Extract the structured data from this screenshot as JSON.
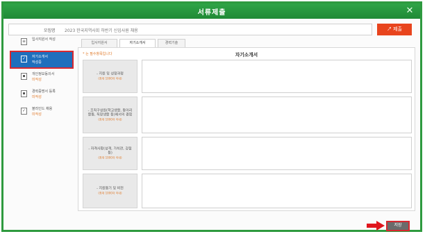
{
  "window": {
    "title": "서류제출",
    "close_glyph": "✕"
  },
  "subject": {
    "label": "모집명",
    "value": "2023 한국지역사회 하반기 신입사원 채용"
  },
  "submit_button": "↗ 제출",
  "sidebar": {
    "items": [
      {
        "label": "입사지원서 작성",
        "status": "",
        "icon": "document-icon",
        "active": false
      },
      {
        "label": "자기소개서",
        "status": "작성중",
        "icon": "edit-icon",
        "active": true
      },
      {
        "label": "개인정보동의서",
        "status": "미작성",
        "icon": "consent-icon",
        "active": false
      },
      {
        "label": "경력증명서 등록",
        "status": "미작성",
        "icon": "certificate-icon",
        "active": false
      },
      {
        "label": "블라인드 채용",
        "status": "미작성",
        "icon": "check-icon",
        "active": false
      }
    ]
  },
  "tabs": [
    {
      "label": "입사지원서",
      "active": false
    },
    {
      "label": "자기소개서",
      "active": true
    },
    {
      "label": "경력기술",
      "active": false
    }
  ],
  "form": {
    "required_note": "* 는 필수항목입니다",
    "title": "자기소개서",
    "questions": [
      {
        "text": "- 지원 및 성장과정",
        "limit": "(최대 1000자 이내)"
      },
      {
        "text": "- 조직구성원(학교생활, 동아리활동, 직장생활 등)에서의 경험",
        "limit": "(최대 1000자 이내)"
      },
      {
        "text": "- 자격사항(성격, 가치관, 강점 등)",
        "limit": "(최대 1000자 이내)"
      },
      {
        "text": "- 지원동기 및 비전",
        "limit": "(최대 1000자 이내)"
      }
    ]
  },
  "save_button": "저장",
  "colors": {
    "frame": "#2e9a3f",
    "accent": "#1f6fbd",
    "submit": "#e8441d",
    "highlight": "#d8282f"
  }
}
